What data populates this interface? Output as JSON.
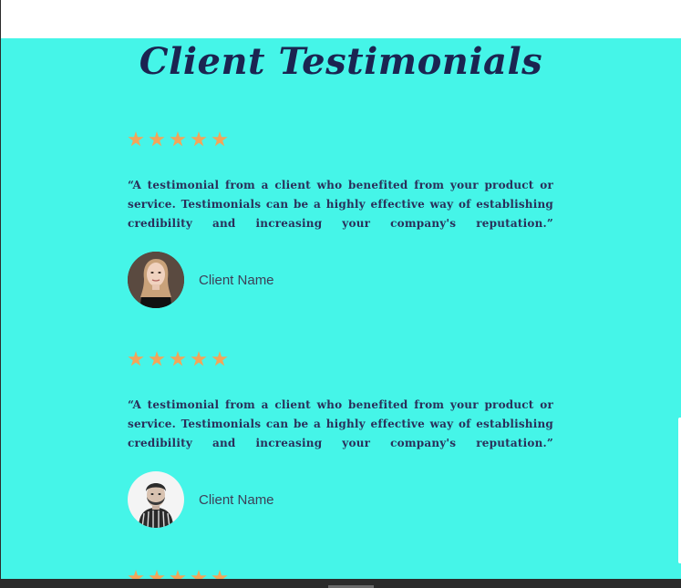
{
  "section": {
    "title": "Client Testimonials",
    "background": "#45f5e8",
    "title_color": "#1b2451",
    "star_color": "#f2a55a"
  },
  "testimonials": [
    {
      "rating": 5,
      "quote": "“A testimonial from a client who benefited from your product or service. Testimonials can be a highly effective way of establishing credibility and increasing your company's reputation.”",
      "client_name": "Client Name",
      "avatar": "woman-portrait"
    },
    {
      "rating": 5,
      "quote": "“A testimonial from a client who benefited from your product or service. Testimonials can be a highly effective way of establishing credibility and increasing your company's reputation.”",
      "client_name": "Client Name",
      "avatar": "man-portrait"
    },
    {
      "rating": 5
    }
  ]
}
